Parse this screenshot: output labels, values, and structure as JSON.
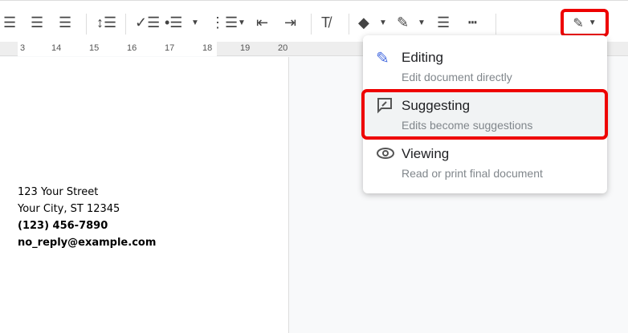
{
  "ruler": {
    "labels": [
      "3",
      "14",
      "15",
      "16",
      "17",
      "18",
      "19",
      "20"
    ]
  },
  "document": {
    "lines": [
      "123 Your Street",
      "Your City, ST 12345",
      "(123) 456-7890",
      "no_reply@example.com"
    ]
  },
  "mode_menu": {
    "items": [
      {
        "title": "Editing",
        "subtitle": "Edit document directly",
        "icon": "pencil-icon"
      },
      {
        "title": "Suggesting",
        "subtitle": "Edits become suggestions",
        "icon": "suggest-icon"
      },
      {
        "title": "Viewing",
        "subtitle": "Read or print final document",
        "icon": "eye-icon"
      }
    ],
    "highlighted": "Suggesting"
  },
  "colors": {
    "highlight": "#e00000",
    "editing_icon": "#4a6ee0"
  }
}
